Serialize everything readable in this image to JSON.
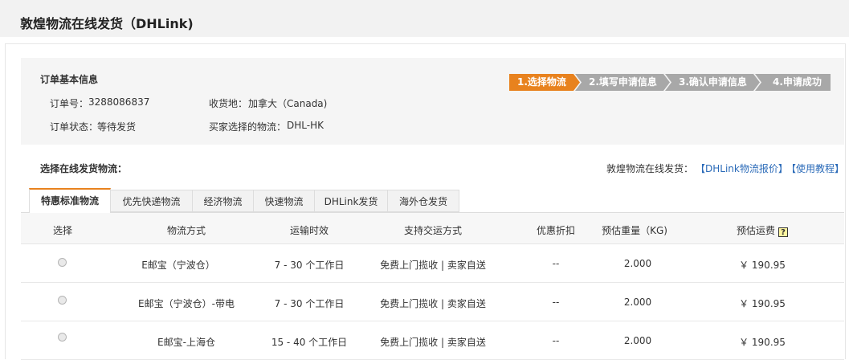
{
  "header": {
    "title": "敦煌物流在线发货（DHLink)"
  },
  "order_info": {
    "title": "订单基本信息",
    "order_no_label": "订单号：",
    "order_no": "3288086837",
    "status_label": "订单状态：",
    "status": "等待发货",
    "destination_label": "收货地：",
    "destination": "加拿大（Canada)",
    "buyer_shipping_label": "买家选择的物流：",
    "buyer_shipping": "DHL-HK"
  },
  "steps": [
    {
      "label": "1.选择物流",
      "active": true
    },
    {
      "label": "2.填写申请信息",
      "active": false
    },
    {
      "label": "3.确认申请信息",
      "active": false
    },
    {
      "label": "4.申请成功",
      "active": false
    }
  ],
  "shipping_section": {
    "title": "选择在线发货物流：",
    "right_text": "敦煌物流在线发货：",
    "link_price": "【DHLink物流报价】",
    "link_tutorial": "【使用教程】"
  },
  "tabs": [
    "特惠标准物流",
    "优先快递物流",
    "经济物流",
    "快速物流",
    "DHLink发货",
    "海外仓发货"
  ],
  "table": {
    "headers": [
      "选择",
      "物流方式",
      "运输时效",
      "支持交运方式",
      "优惠折扣",
      "预估重量（KG)",
      "预估运费"
    ],
    "help_icon_text": "?",
    "rows": [
      {
        "method": "E邮宝（宁波仓）",
        "time": "7 - 30 个工作日",
        "delivery": "免费上门揽收 | 卖家自送",
        "discount": "--",
        "weight": "2.000",
        "fee": "￥ 190.95"
      },
      {
        "method": "E邮宝（宁波仓）-带电",
        "time": "7 - 30 个工作日",
        "delivery": "免费上门揽收 | 卖家自送",
        "discount": "--",
        "weight": "2.000",
        "fee": "￥ 190.95"
      },
      {
        "method": "E邮宝-上海仓",
        "time": "15 - 40 个工作日",
        "delivery": "免费上门揽收 | 卖家自送",
        "discount": "--",
        "weight": "2.000",
        "fee": "￥ 190.95"
      }
    ]
  },
  "colors": {
    "accent": "#e8821e",
    "step_inactive": "#a8a8a8",
    "link": "#2a6ab8"
  }
}
